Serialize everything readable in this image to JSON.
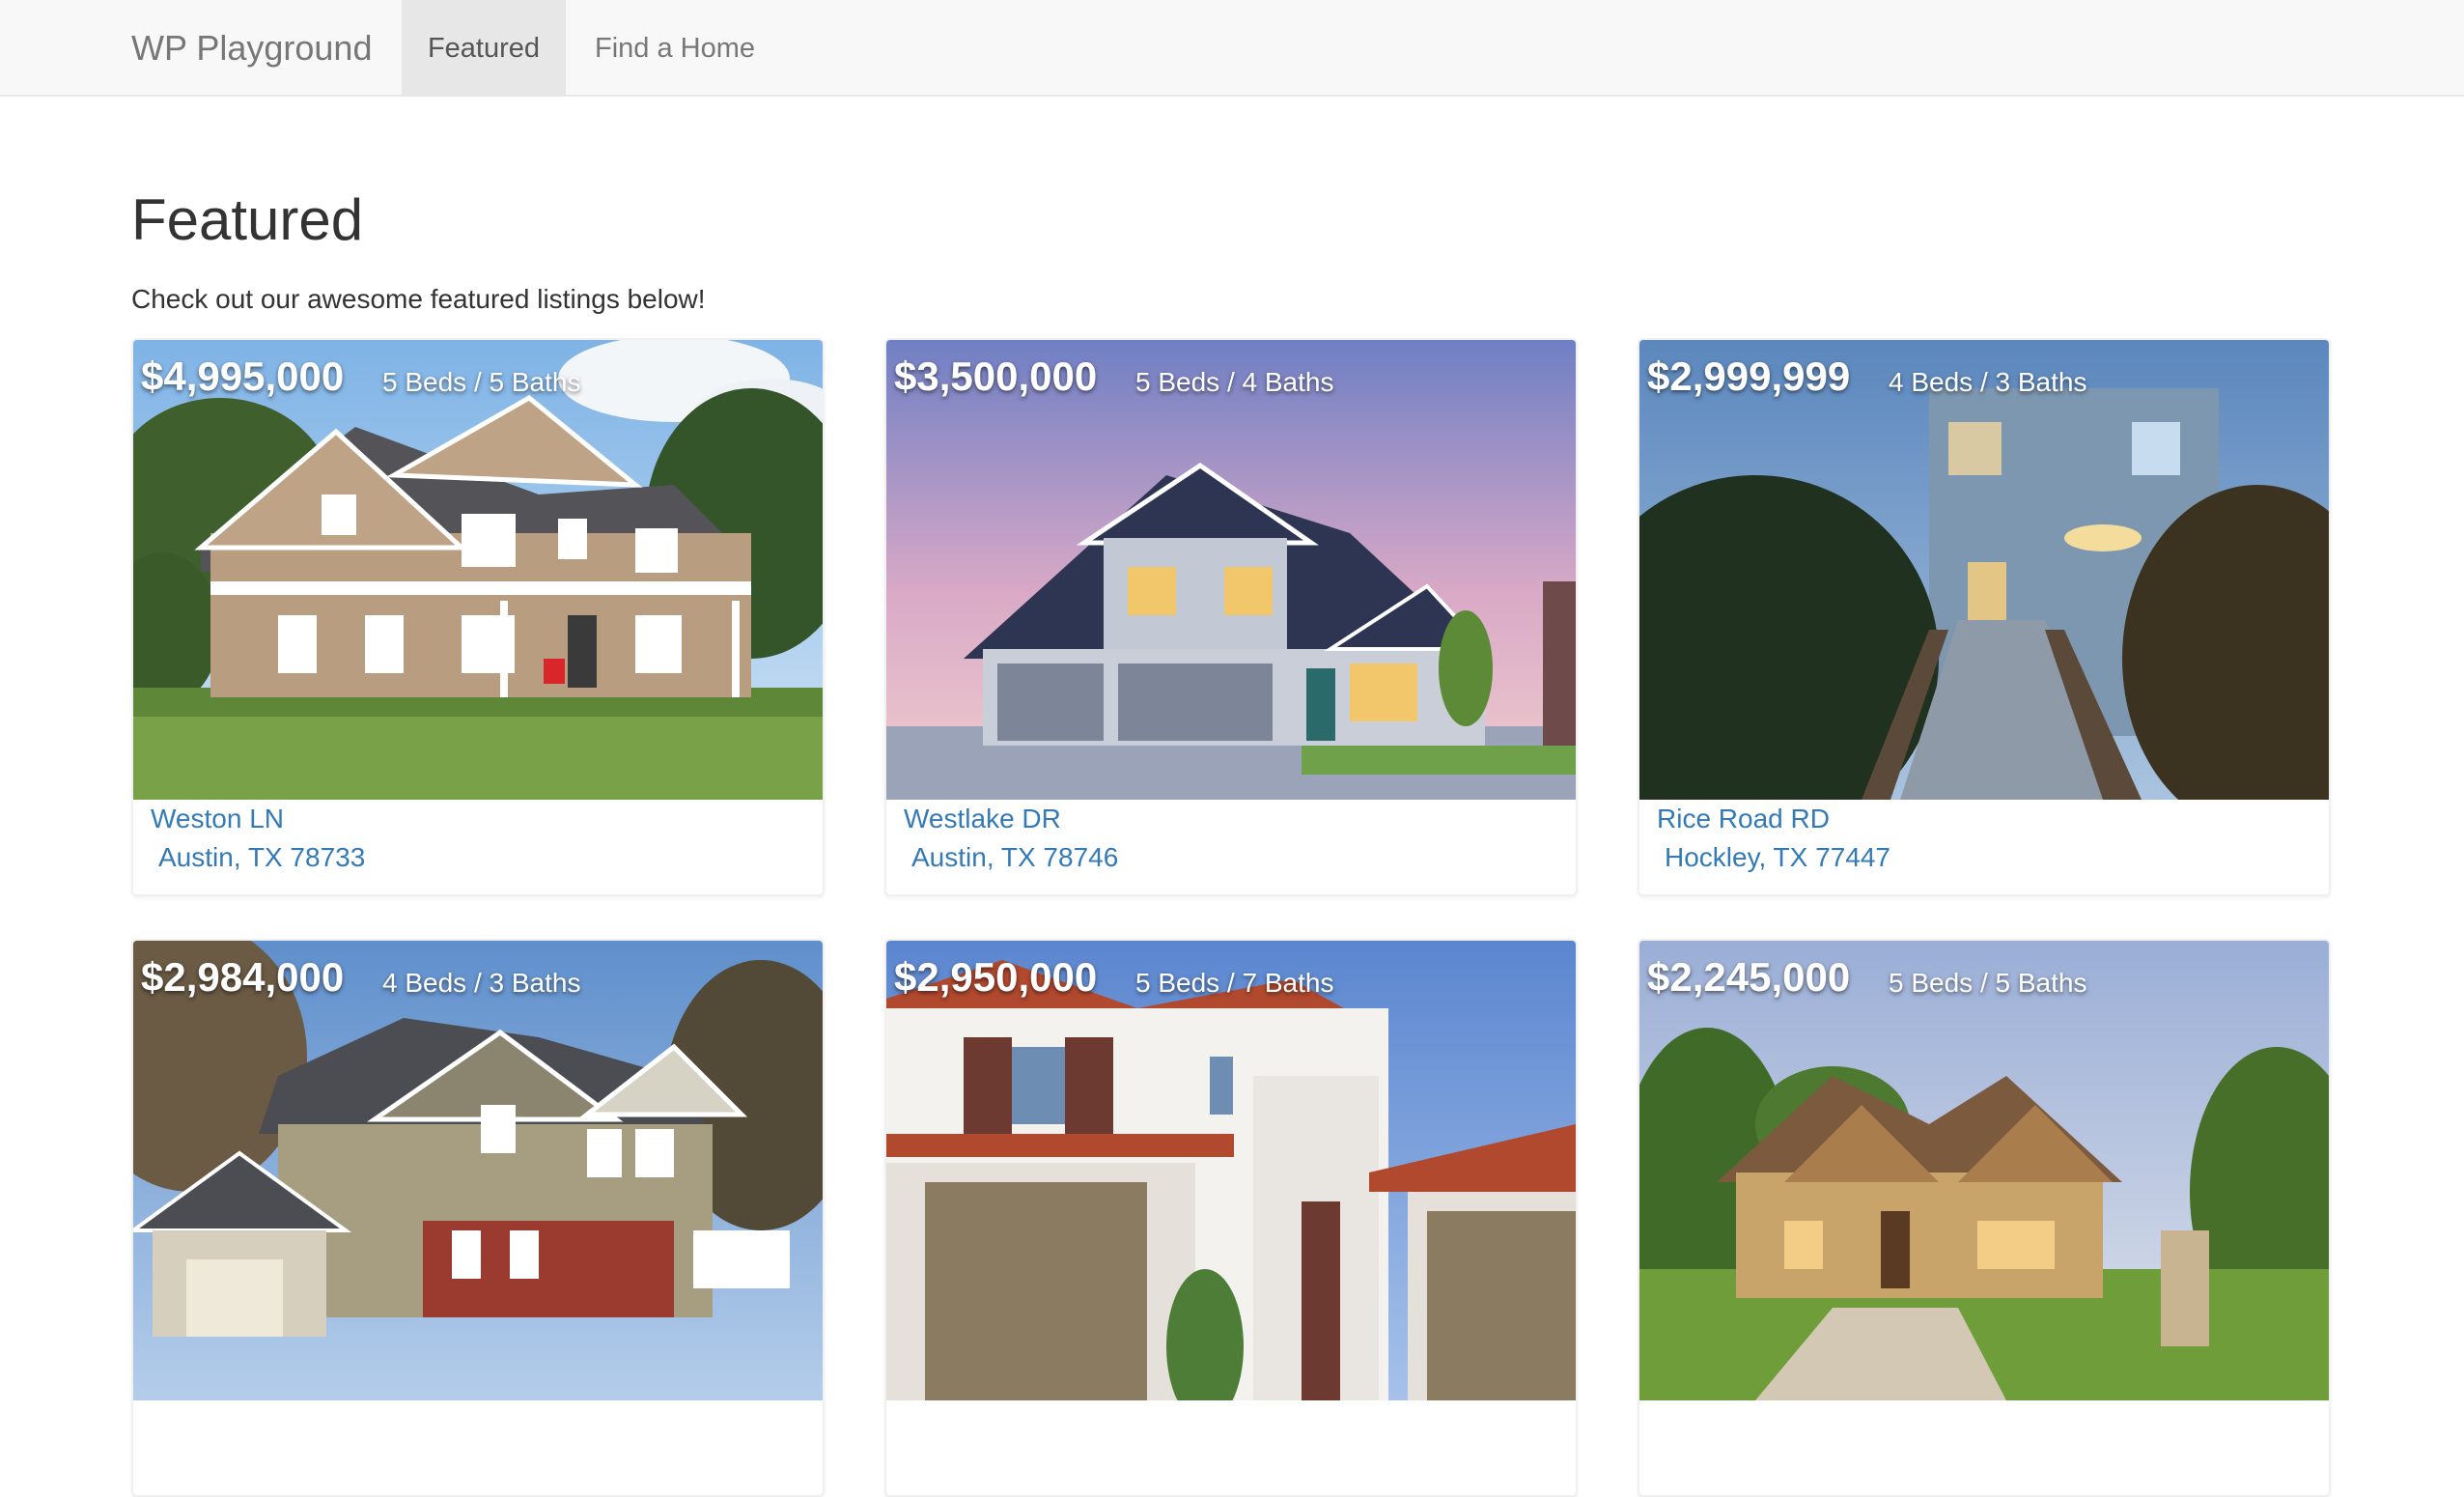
{
  "nav": {
    "brand": "WP Playground",
    "items": [
      {
        "label": "Featured",
        "active": true
      },
      {
        "label": "Find a Home",
        "active": false
      }
    ]
  },
  "page": {
    "title": "Featured",
    "subtitle": "Check out our awesome featured listings below!"
  },
  "listings": [
    {
      "price": "$4,995,000",
      "beds_baths": "5 Beds / 5 Baths",
      "street": "Weston LN",
      "city": "Austin, TX 78733"
    },
    {
      "price": "$3,500,000",
      "beds_baths": "5 Beds / 4 Baths",
      "street": "Westlake DR",
      "city": "Austin, TX 78746"
    },
    {
      "price": "$2,999,999",
      "beds_baths": "4 Beds / 3 Baths",
      "street": "Rice Road RD",
      "city": "Hockley, TX 77447"
    },
    {
      "price": "$2,984,000",
      "beds_baths": "4 Beds / 3 Baths",
      "street": "",
      "city": ""
    },
    {
      "price": "$2,950,000",
      "beds_baths": "5 Beds / 7 Baths",
      "street": "",
      "city": ""
    },
    {
      "price": "$2,245,000",
      "beds_baths": "5 Beds / 5 Baths",
      "street": "",
      "city": ""
    }
  ],
  "colors": {
    "navbar_bg": "#f8f8f8",
    "nav_active_bg": "#e7e7e7",
    "link": "#337ab7",
    "heading": "#333333"
  }
}
